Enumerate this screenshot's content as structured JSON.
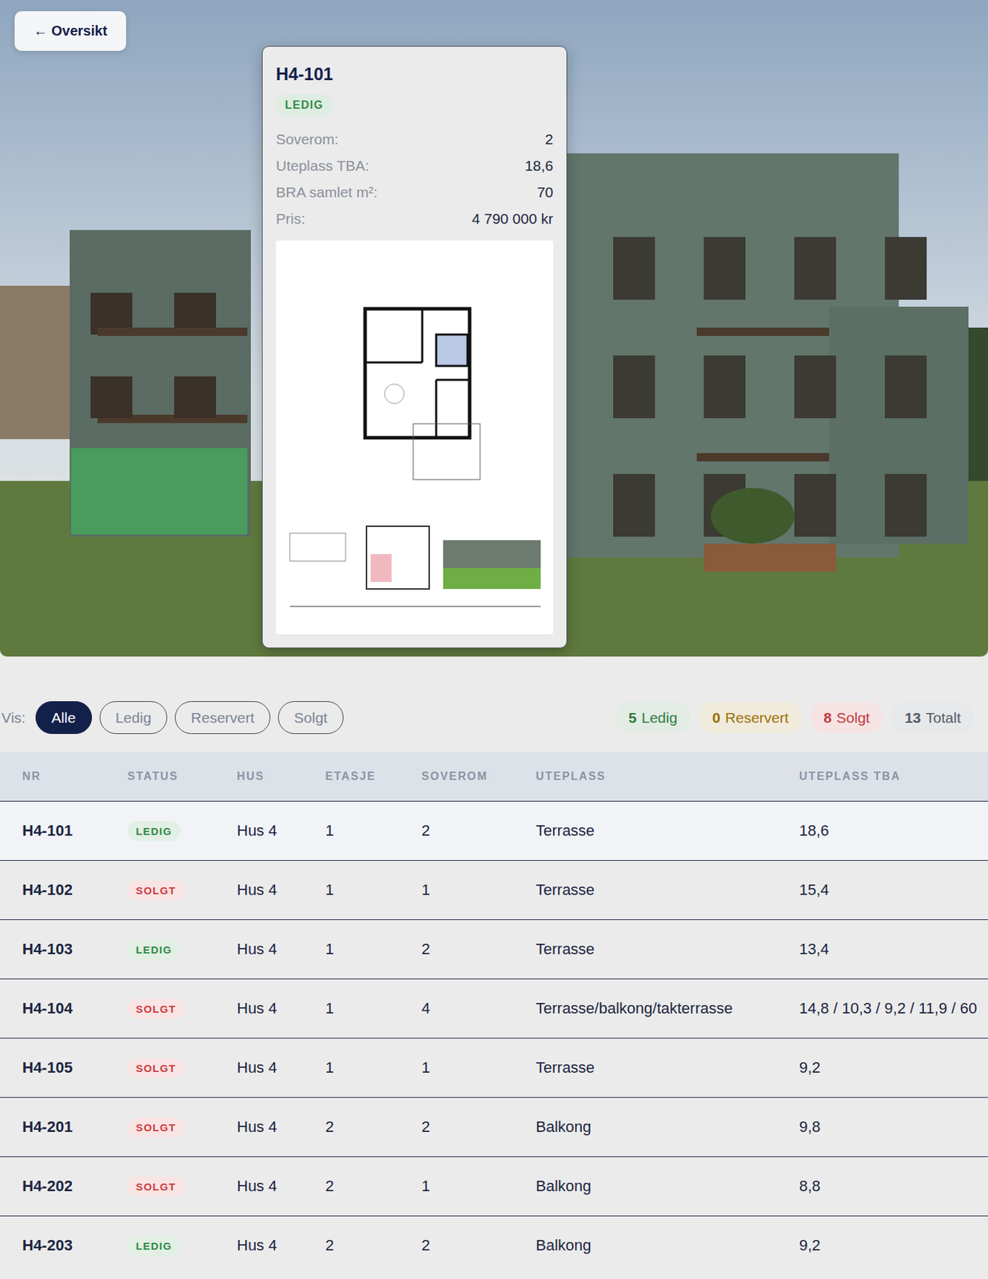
{
  "back_button": {
    "label": "← Oversikt"
  },
  "hero": {
    "highlight_color": "#3cc45a"
  },
  "popup": {
    "title": "H4-101",
    "status": "LEDIG",
    "color": "#2f8a45",
    "fields": [
      {
        "label": "Soverom:",
        "value": "2"
      },
      {
        "label": "Uteplass TBA:",
        "value": "18,6"
      },
      {
        "label": "BRA samlet m²:",
        "value": "70"
      },
      {
        "label": "Pris:",
        "value": "4 790 000 kr"
      }
    ]
  },
  "filters": {
    "label": "Vis:",
    "options": [
      {
        "label": "Alle",
        "selected": true
      },
      {
        "label": "Ledig",
        "selected": false
      },
      {
        "label": "Reservert",
        "selected": false
      },
      {
        "label": "Solgt",
        "selected": false
      }
    ]
  },
  "counts": [
    {
      "count": "5",
      "label": "Ledig",
      "color": "#2f7a3d"
    },
    {
      "count": "0",
      "label": "Reservert",
      "color": "#9a6f05"
    },
    {
      "count": "8",
      "label": "Solgt",
      "color": "#c0393b"
    },
    {
      "count": "13",
      "label": "Totalt",
      "color": "#555b66"
    }
  ],
  "table": {
    "columns": [
      "NR",
      "STATUS",
      "HUS",
      "ETASJE",
      "SOVEROM",
      "UTEPLASS",
      "UTEPLASS TBA"
    ],
    "rows": [
      {
        "nr": "H4-101",
        "status": "LEDIG",
        "color": "#2f8a45",
        "hus": "Hus 4",
        "etasje": "1",
        "soverom": "2",
        "uteplass": "Terrasse",
        "tba": "18,6",
        "selected": true
      },
      {
        "nr": "H4-102",
        "status": "SOLGT",
        "color": "#cc3b3f",
        "hus": "Hus 4",
        "etasje": "1",
        "soverom": "1",
        "uteplass": "Terrasse",
        "tba": "15,4",
        "selected": false
      },
      {
        "nr": "H4-103",
        "status": "LEDIG",
        "color": "#2f8a45",
        "hus": "Hus 4",
        "etasje": "1",
        "soverom": "2",
        "uteplass": "Terrasse",
        "tba": "13,4",
        "selected": false
      },
      {
        "nr": "H4-104",
        "status": "SOLGT",
        "color": "#cc3b3f",
        "hus": "Hus 4",
        "etasje": "1",
        "soverom": "4",
        "uteplass": "Terrasse/balkong/takterrasse",
        "tba": "14,8 / 10,3 / 9,2 / 11,9 / 60",
        "selected": false
      },
      {
        "nr": "H4-105",
        "status": "SOLGT",
        "color": "#cc3b3f",
        "hus": "Hus 4",
        "etasje": "1",
        "soverom": "1",
        "uteplass": "Terrasse",
        "tba": "9,2",
        "selected": false
      },
      {
        "nr": "H4-201",
        "status": "SOLGT",
        "color": "#cc3b3f",
        "hus": "Hus 4",
        "etasje": "2",
        "soverom": "2",
        "uteplass": "Balkong",
        "tba": "9,8",
        "selected": false
      },
      {
        "nr": "H4-202",
        "status": "SOLGT",
        "color": "#cc3b3f",
        "hus": "Hus 4",
        "etasje": "2",
        "soverom": "1",
        "uteplass": "Balkong",
        "tba": "8,8",
        "selected": false
      },
      {
        "nr": "H4-203",
        "status": "LEDIG",
        "color": "#2f8a45",
        "hus": "Hus 4",
        "etasje": "2",
        "soverom": "2",
        "uteplass": "Balkong",
        "tba": "9,2",
        "selected": false
      }
    ]
  }
}
